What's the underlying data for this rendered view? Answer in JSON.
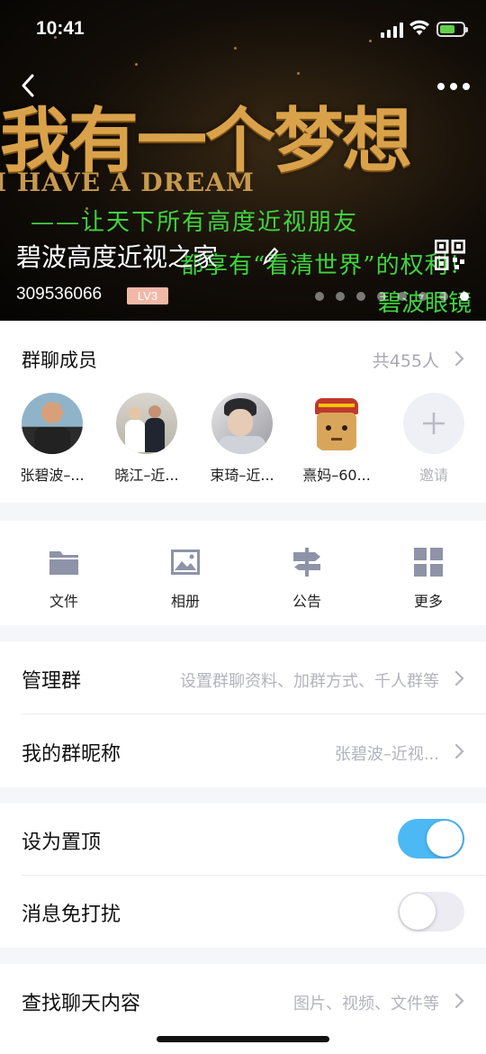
{
  "status_bar": {
    "time": "10:41"
  },
  "banner": {
    "headline_cn": "我有一个梦想",
    "headline_en": "I HAVE A DREAM",
    "slogan_line1": "——让天下所有高度近视朋友",
    "slogan_line2": "都享有“看清世界”的权利！",
    "brand": "碧波眼镜"
  },
  "header": {
    "group_name": "碧波高度近视之家",
    "group_id": "309536066",
    "level": "LV3",
    "page_indicator": {
      "count": 8,
      "active": 7
    }
  },
  "members": {
    "title": "群聊成员",
    "count_text": "共455人",
    "list": [
      {
        "name": "张碧波–..."
      },
      {
        "name": "晓江–近..."
      },
      {
        "name": "束琦–近..."
      },
      {
        "name": "熹妈–60..."
      }
    ],
    "invite_label": "邀请"
  },
  "tools": [
    {
      "label": "文件",
      "icon": "folder-icon"
    },
    {
      "label": "相册",
      "icon": "photo-icon"
    },
    {
      "label": "公告",
      "icon": "signpost-icon"
    },
    {
      "label": "更多",
      "icon": "grid-icon"
    }
  ],
  "settings": {
    "manage_group": {
      "title": "管理群",
      "value": "设置群聊资料、加群方式、千人群等"
    },
    "my_nickname": {
      "title": "我的群昵称",
      "value": "张碧波–近视..."
    },
    "pin_top": {
      "title": "设为置顶",
      "enabled": true
    },
    "do_not_disturb": {
      "title": "消息免打扰",
      "enabled": false
    },
    "search_history": {
      "title": "查找聊天内容",
      "value": "图片、视频、文件等"
    }
  },
  "colors": {
    "toggle_on": "#4cb9f5",
    "toggle_off": "#ececf2",
    "secondary_text": "#b3b4bc",
    "icon_gray": "#8e93a8",
    "banner_gold": "#d9a24a",
    "banner_green": "#3fd43f"
  }
}
